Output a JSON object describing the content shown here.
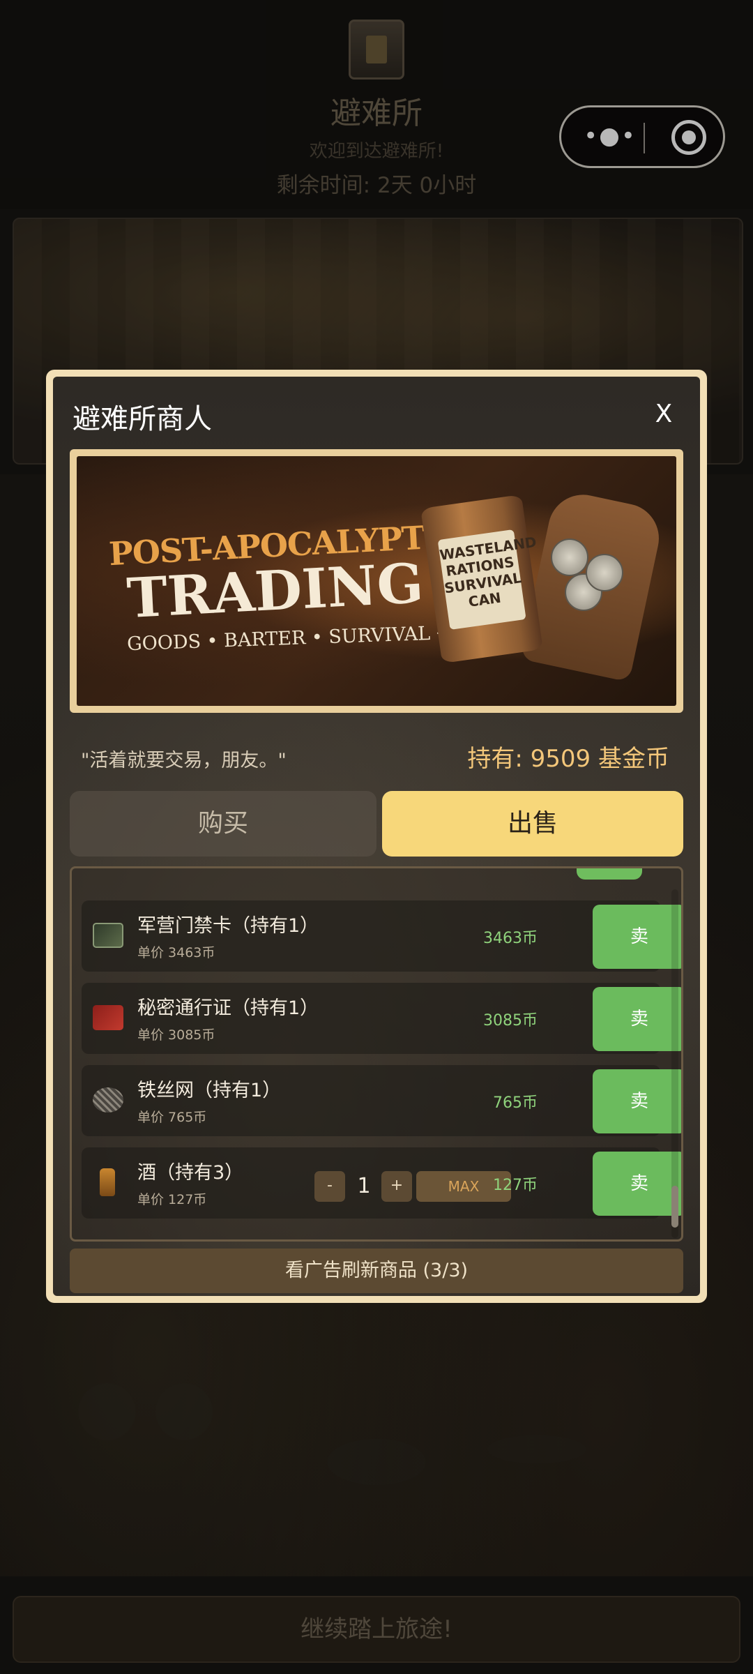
{
  "header": {
    "title": "避难所",
    "welcome": "欢迎到达避难所!",
    "time_remaining": "剩余时间: 2天 0小时"
  },
  "capsule": {
    "more_icon": "more-dots-icon",
    "close_icon": "target-circle-icon"
  },
  "continue_button": "继续踏上旅途!",
  "modal": {
    "title": "避难所商人",
    "close_label": "X",
    "banner": {
      "line1": "POST-APOCALYPTIC",
      "line2": "TRADING",
      "line3": "GOODS • BARTER • SURVIVAL →",
      "can_label": "WASTELAND RATIONS SURVIVAL CAN"
    },
    "quote": "\"活着就要交易，朋友。\"",
    "holding": "持有: 9509 基金币",
    "tabs": {
      "buy": "购买",
      "sell": "出售",
      "active": "sell"
    },
    "items": [
      {
        "name": "军营门禁卡（持有1）",
        "unit_price": "单价 3463币",
        "total": "3463币",
        "sell_label": "卖",
        "icon": "keycard-icon"
      },
      {
        "name": "秘密通行证（持有1）",
        "unit_price": "单价 3085币",
        "total": "3085币",
        "sell_label": "卖",
        "icon": "pass-icon"
      },
      {
        "name": "铁丝网（持有1）",
        "unit_price": "单价 765币",
        "total": "765币",
        "sell_label": "卖",
        "icon": "barbed-wire-icon"
      },
      {
        "name": "酒（持有3）",
        "unit_price": "单价 127币",
        "total": "127币",
        "sell_label": "卖",
        "icon": "liquor-bottle-icon",
        "quantity": {
          "minus": "-",
          "value": "1",
          "plus": "+",
          "max": "MAX"
        }
      }
    ],
    "refresh_button": "看广告刷新商品 (3/3)"
  }
}
